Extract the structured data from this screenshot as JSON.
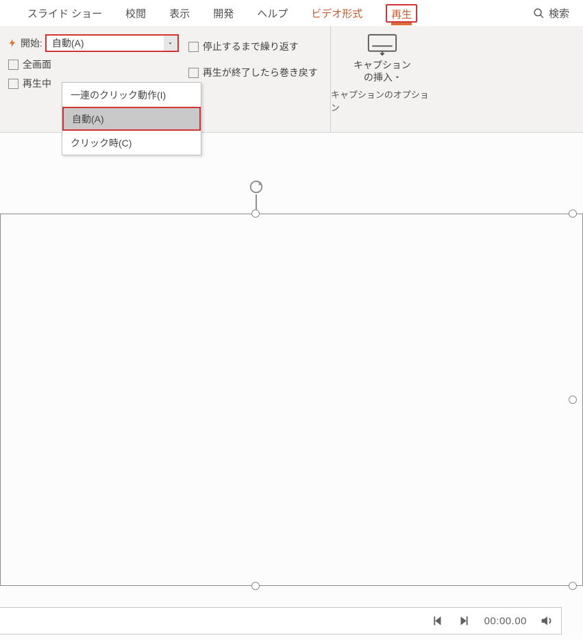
{
  "tabs": {
    "slideshow": "スライド ショー",
    "review": "校閲",
    "view": "表示",
    "developer": "開発",
    "help": "ヘルプ",
    "video_fmt": "ビデオ形式",
    "playback": "再生",
    "search": "検索"
  },
  "ribbon": {
    "start_label": "開始:",
    "start_value": "自動(A)",
    "dropdown": {
      "in_click": "一連のクリック動作(I)",
      "auto": "自動(A)",
      "on_click": "クリック時(C)"
    },
    "fullscreen": "全画面",
    "hide_playing": "再生中",
    "loop_until_stop": "停止するまで繰り返す",
    "rewind_after": "再生が終了したら巻き戻す",
    "caption_l1": "キャプション",
    "caption_l2": "の挿入",
    "caption_group": "キャプションのオプション"
  },
  "player": {
    "time": "00:00.00"
  }
}
